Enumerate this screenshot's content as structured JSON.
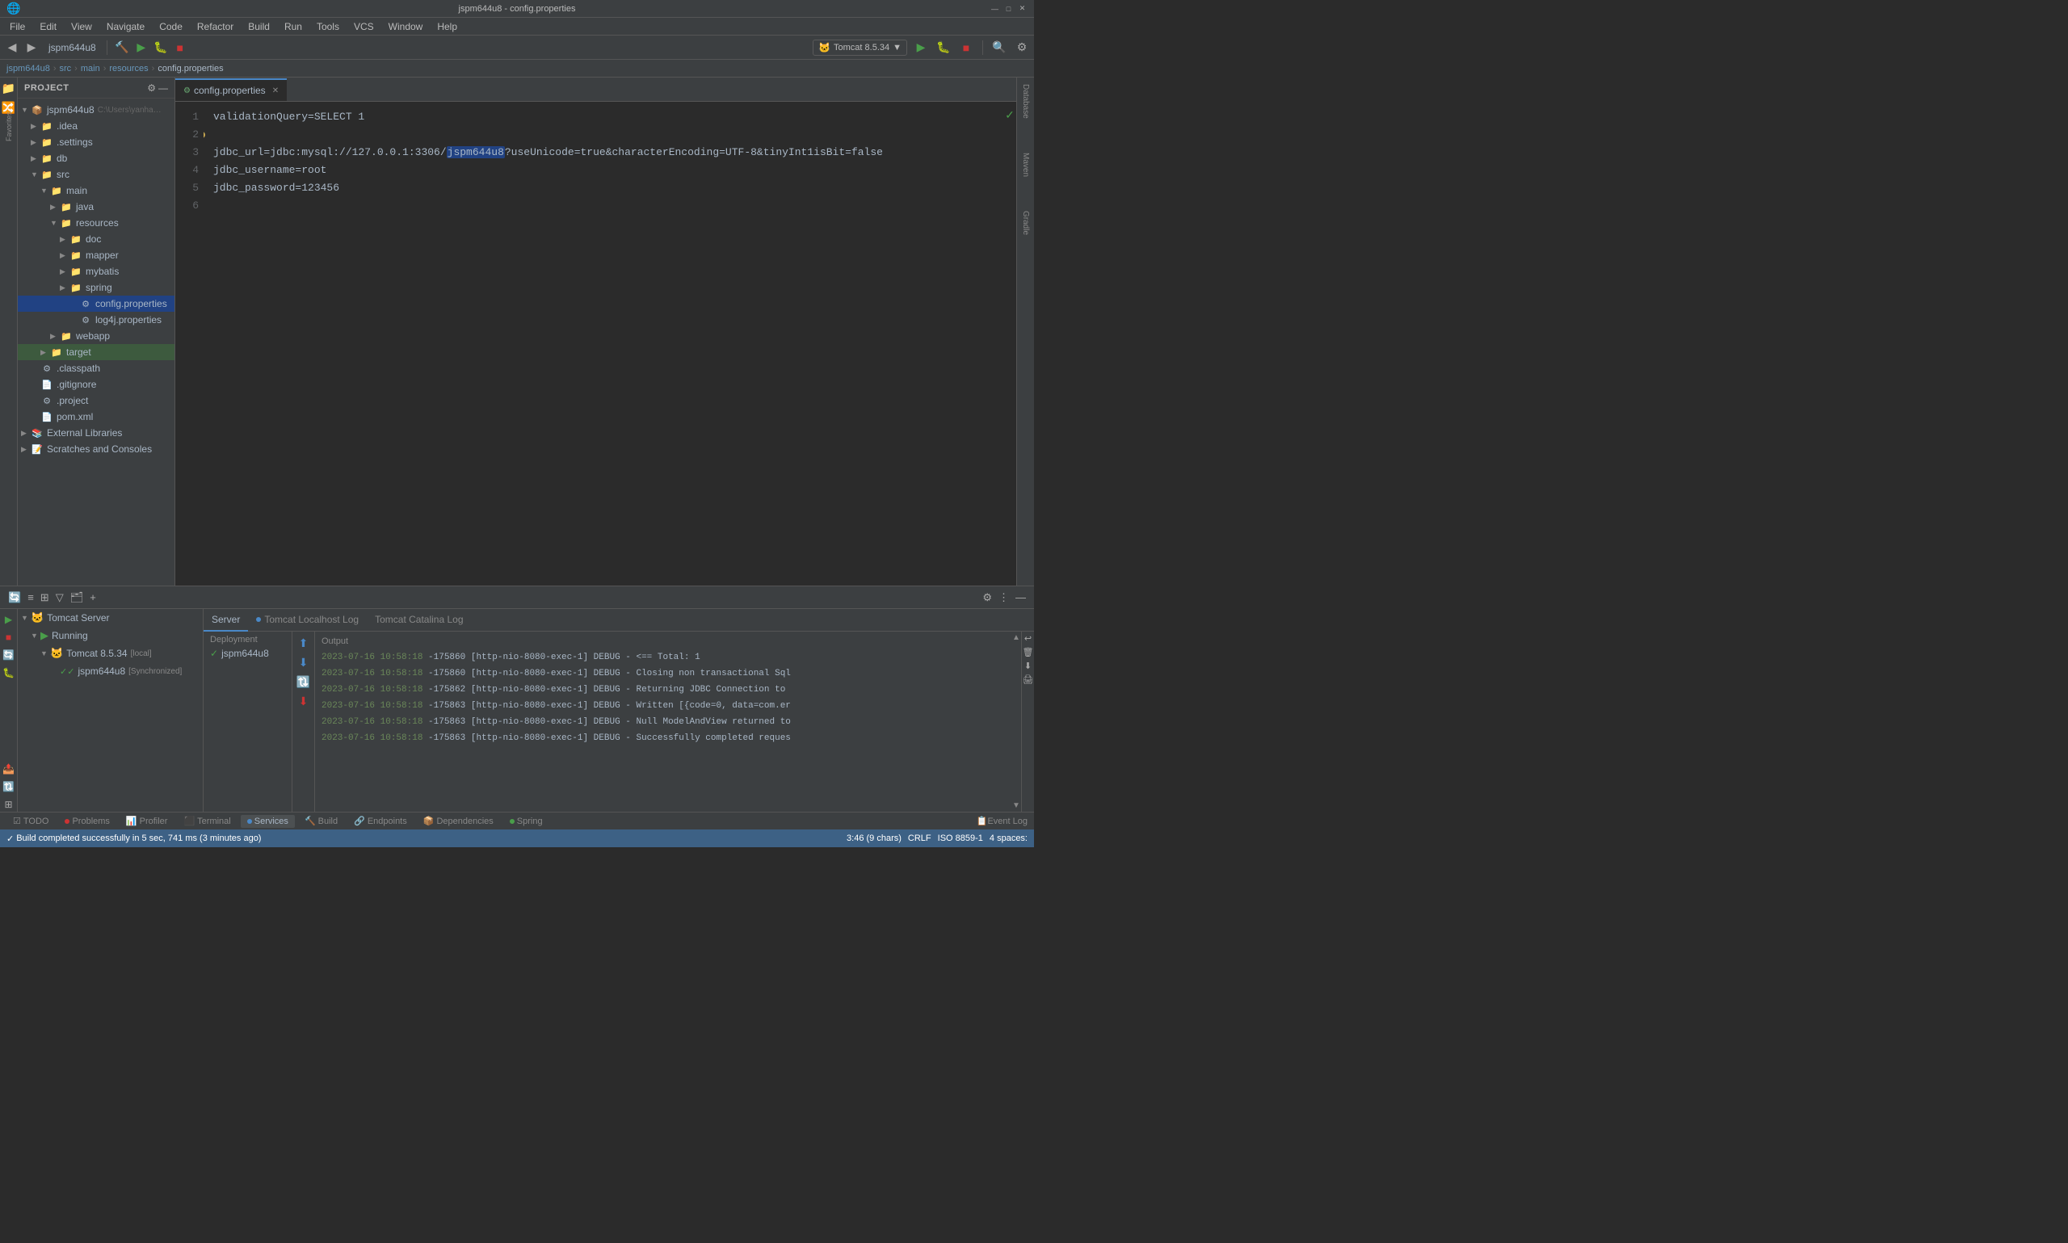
{
  "titleBar": {
    "title": "jspm644u8 - config.properties",
    "windowControls": {
      "minimize": "—",
      "maximize": "□",
      "close": "✕"
    }
  },
  "menuBar": {
    "items": [
      "File",
      "Edit",
      "View",
      "Navigate",
      "Code",
      "Refactor",
      "Build",
      "Run",
      "Tools",
      "VCS",
      "Window",
      "Help"
    ]
  },
  "toolbar": {
    "projectName": "jspm644u8",
    "runConfig": "Tomcat 8.5.34",
    "runConfigIcon": "🐱"
  },
  "navBar": {
    "path": [
      "jspm644u8",
      "src",
      "main",
      "resources",
      "config.properties"
    ]
  },
  "sidebar": {
    "title": "Project",
    "tree": [
      {
        "id": "jspm644u8-root",
        "label": "jspm644u8",
        "indent": 0,
        "arrow": "▼",
        "icon": "📁",
        "type": "project",
        "extra": "C:\\Users\\yanhao\\Desktop\\demo\\ssm母婴用品网站·yes"
      },
      {
        "id": "idea",
        "label": ".idea",
        "indent": 1,
        "arrow": "▶",
        "icon": "📁",
        "type": "folder"
      },
      {
        "id": "settings",
        "label": ".settings",
        "indent": 1,
        "arrow": "▶",
        "icon": "📁",
        "type": "folder"
      },
      {
        "id": "db",
        "label": "db",
        "indent": 1,
        "arrow": "▶",
        "icon": "📁",
        "type": "folder"
      },
      {
        "id": "src",
        "label": "src",
        "indent": 1,
        "arrow": "▼",
        "icon": "📁",
        "type": "folder"
      },
      {
        "id": "main",
        "label": "main",
        "indent": 2,
        "arrow": "▼",
        "icon": "📁",
        "type": "folder"
      },
      {
        "id": "java",
        "label": "java",
        "indent": 3,
        "arrow": "▶",
        "icon": "📁",
        "type": "folder-source"
      },
      {
        "id": "resources",
        "label": "resources",
        "indent": 3,
        "arrow": "▼",
        "icon": "📁",
        "type": "folder-resource"
      },
      {
        "id": "doc",
        "label": "doc",
        "indent": 4,
        "arrow": "▶",
        "icon": "📁",
        "type": "folder"
      },
      {
        "id": "mapper",
        "label": "mapper",
        "indent": 4,
        "arrow": "▶",
        "icon": "📁",
        "type": "folder"
      },
      {
        "id": "mybatis",
        "label": "mybatis",
        "indent": 4,
        "arrow": "▶",
        "icon": "📁",
        "type": "folder"
      },
      {
        "id": "spring",
        "label": "spring",
        "indent": 4,
        "arrow": "▶",
        "icon": "📁",
        "type": "folder"
      },
      {
        "id": "config-props",
        "label": "config.properties",
        "indent": 5,
        "arrow": "",
        "icon": "⚙",
        "type": "file",
        "selected": true
      },
      {
        "id": "log4j-props",
        "label": "log4j.properties",
        "indent": 5,
        "arrow": "",
        "icon": "⚙",
        "type": "file"
      },
      {
        "id": "webapp",
        "label": "webapp",
        "indent": 3,
        "arrow": "▶",
        "icon": "📁",
        "type": "folder"
      },
      {
        "id": "target",
        "label": "target",
        "indent": 2,
        "arrow": "▶",
        "icon": "📁",
        "type": "folder",
        "highlighted": true
      },
      {
        "id": "classpath",
        "label": ".classpath",
        "indent": 1,
        "arrow": "",
        "icon": "⚙",
        "type": "file"
      },
      {
        "id": "gitignore",
        "label": ".gitignore",
        "indent": 1,
        "arrow": "",
        "icon": "📄",
        "type": "file"
      },
      {
        "id": "project",
        "label": ".project",
        "indent": 1,
        "arrow": "",
        "icon": "⚙",
        "type": "file"
      },
      {
        "id": "pom",
        "label": "pom.xml",
        "indent": 1,
        "arrow": "",
        "icon": "📄",
        "type": "file"
      },
      {
        "id": "external-libs",
        "label": "External Libraries",
        "indent": 0,
        "arrow": "▶",
        "icon": "📚",
        "type": "folder"
      },
      {
        "id": "scratches",
        "label": "Scratches and Consoles",
        "indent": 0,
        "arrow": "▶",
        "icon": "📝",
        "type": "folder"
      }
    ]
  },
  "editor": {
    "tabs": [
      {
        "id": "config-props-tab",
        "label": "config.properties",
        "icon": "⚙",
        "active": true
      }
    ],
    "lines": [
      {
        "num": 1,
        "content": "validationQuery=SELECT 1",
        "type": "normal"
      },
      {
        "num": 2,
        "content": "",
        "type": "warning"
      },
      {
        "num": 3,
        "content": "jdbc_url=jdbc:mysql://127.0.0.1:3306/jspm644u8?useUnicode=true&characterEncoding=UTF-8&tinyInt1isBit=false",
        "type": "highlight",
        "highlightWord": "jspm644u8"
      },
      {
        "num": 4,
        "content": "jdbc_username=root",
        "type": "normal"
      },
      {
        "num": 5,
        "content": "jdbc_password=123456",
        "type": "normal"
      },
      {
        "num": 6,
        "content": "",
        "type": "normal"
      }
    ]
  },
  "bottomPanel": {
    "title": "Services",
    "tabs": {
      "server": "Server",
      "localhostLog": "Tomcat Localhost Log",
      "catalinaLog": "Tomcat Catalina Log"
    },
    "deployment": {
      "label": "Deployment",
      "items": [
        {
          "name": "jspm644u8",
          "icon": "✓"
        }
      ]
    },
    "output": {
      "label": "Output",
      "logs": [
        {
          "timestamp": "2023-07-16 10:58:18",
          "thread": "-175860",
          "threadId": "[http-nio-8080-exec-1]",
          "level": "DEBUG",
          "message": "-  <==      Total: 1"
        },
        {
          "timestamp": "2023-07-16 10:58:18",
          "thread": "-175860",
          "threadId": "[http-nio-8080-exec-1]",
          "level": "DEBUG",
          "message": "- Closing non transactional Sql"
        },
        {
          "timestamp": "2023-07-16 10:58:18",
          "thread": "-175862",
          "threadId": "[http-nio-8080-exec-1]",
          "level": "DEBUG",
          "message": "- Returning JDBC Connection to"
        },
        {
          "timestamp": "2023-07-16 10:58:18",
          "thread": "-175863",
          "threadId": "[http-nio-8080-exec-1]",
          "level": "DEBUG",
          "message": "- Written [{code=0, data=com.er"
        },
        {
          "timestamp": "2023-07-16 10:58:18",
          "thread": "-175863",
          "threadId": "[http-nio-8080-exec-1]",
          "level": "DEBUG",
          "message": "- Null ModelAndView returned to"
        },
        {
          "timestamp": "2023-07-16 10:58:18",
          "thread": "-175863",
          "threadId": "[http-nio-8080-exec-1]",
          "level": "DEBUG",
          "message": "- Successfully completed reques"
        }
      ]
    },
    "services": {
      "tree": [
        {
          "id": "tomcat-server",
          "label": "Tomcat Server",
          "indent": 0,
          "arrow": "▼",
          "icon": "🐱"
        },
        {
          "id": "running",
          "label": "Running",
          "indent": 1,
          "arrow": "▼",
          "icon": "▶"
        },
        {
          "id": "tomcat-instance",
          "label": "Tomcat 8.5.34",
          "indent": 2,
          "arrow": "▼",
          "icon": "🐱",
          "badge": "[local]"
        },
        {
          "id": "jspm644u8-deploy",
          "label": "jspm644u8",
          "indent": 3,
          "arrow": "",
          "icon": "✓✓",
          "badge": "[Synchronized]"
        }
      ]
    }
  },
  "statusBar": {
    "buildMessage": "Build completed successfully in 5 sec, 741 ms (3 minutes ago)",
    "rightItems": [
      "3:46 (9 chars)",
      "CRLF",
      "ISO 8859-1",
      "4 spaces:"
    ]
  },
  "bottomTabBar": {
    "tabs": [
      {
        "id": "todo",
        "label": "TODO",
        "icon": "list"
      },
      {
        "id": "problems",
        "label": "Problems",
        "icon": "warning",
        "dotColor": "red"
      },
      {
        "id": "profiler",
        "label": "Profiler",
        "icon": "profile",
        "dotColor": "none"
      },
      {
        "id": "terminal",
        "label": "Terminal",
        "icon": "terminal"
      },
      {
        "id": "services",
        "label": "Services",
        "icon": "services",
        "dotColor": "blue",
        "active": true
      },
      {
        "id": "build",
        "label": "Build",
        "icon": "build"
      },
      {
        "id": "endpoints",
        "label": "Endpoints",
        "icon": "endpoints"
      },
      {
        "id": "dependencies",
        "label": "Dependencies",
        "icon": "deps"
      },
      {
        "id": "spring",
        "label": "Spring",
        "icon": "spring",
        "dotColor": "green"
      }
    ]
  },
  "rightPanel": {
    "tabs": [
      "Database",
      "Maven",
      "Gradle"
    ]
  }
}
